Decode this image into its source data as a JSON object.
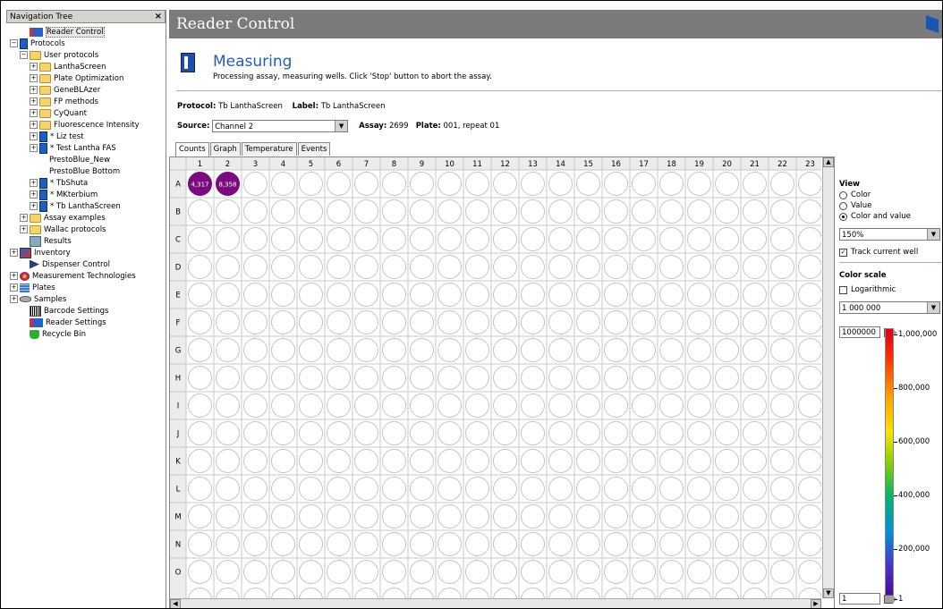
{
  "nav": {
    "title": "Navigation Tree",
    "close": "×",
    "items": [
      {
        "label": "Reader Control",
        "level": 1,
        "icon": "reader-control-icon",
        "cls": "reader",
        "expander": "",
        "selected": true
      },
      {
        "label": "Protocols",
        "level": 0,
        "icon": "protocol-icon",
        "cls": "proto",
        "expander": "−"
      },
      {
        "label": "User protocols",
        "level": 1,
        "icon": "folder-icon",
        "cls": "folder",
        "expander": "−"
      },
      {
        "label": "LanthaScreen",
        "level": 2,
        "icon": "folder-icon",
        "cls": "folder",
        "expander": "+"
      },
      {
        "label": "Plate Optimization",
        "level": 2,
        "icon": "folder-icon",
        "cls": "folder",
        "expander": "+"
      },
      {
        "label": "GeneBLAzer",
        "level": 2,
        "icon": "folder-icon",
        "cls": "folder",
        "expander": "+"
      },
      {
        "label": "FP methods",
        "level": 2,
        "icon": "folder-icon",
        "cls": "folder",
        "expander": "+"
      },
      {
        "label": "CyQuant",
        "level": 2,
        "icon": "folder-icon",
        "cls": "folder",
        "expander": "+"
      },
      {
        "label": "Fluorescence Intensity",
        "level": 2,
        "icon": "folder-icon",
        "cls": "folder",
        "expander": "+"
      },
      {
        "label": "* Liz test",
        "level": 2,
        "icon": "protocol-icon",
        "cls": "proto",
        "expander": "+"
      },
      {
        "label": "* Test Lantha FAS",
        "level": 2,
        "icon": "protocol-icon",
        "cls": "proto",
        "expander": "+"
      },
      {
        "label": "PrestoBlue_New",
        "level": 3,
        "icon": "",
        "cls": "",
        "expander": ""
      },
      {
        "label": "PrestoBlue Bottom",
        "level": 3,
        "icon": "",
        "cls": "",
        "expander": ""
      },
      {
        "label": "* TbShuta",
        "level": 2,
        "icon": "protocol-icon",
        "cls": "proto",
        "expander": "+"
      },
      {
        "label": "* MKterbium",
        "level": 2,
        "icon": "protocol-icon",
        "cls": "proto",
        "expander": "+"
      },
      {
        "label": "* Tb LanthaScreen",
        "level": 2,
        "icon": "protocol-icon",
        "cls": "proto",
        "expander": "+"
      },
      {
        "label": "Assay examples",
        "level": 1,
        "icon": "folder-icon",
        "cls": "folder",
        "expander": "+"
      },
      {
        "label": "Wallac protocols",
        "level": 1,
        "icon": "folder-icon",
        "cls": "folder",
        "expander": "+"
      },
      {
        "label": "Results",
        "level": 1,
        "icon": "results-icon",
        "cls": "results",
        "expander": ""
      },
      {
        "label": "Inventory",
        "level": 0,
        "icon": "inventory-icon",
        "cls": "inv",
        "expander": "+"
      },
      {
        "label": "Dispenser Control",
        "level": 1,
        "icon": "dispenser-icon",
        "cls": "disp",
        "expander": ""
      },
      {
        "label": "Measurement Technologies",
        "level": 0,
        "icon": "measurement-icon",
        "cls": "meas",
        "expander": "+"
      },
      {
        "label": "Plates",
        "level": 0,
        "icon": "plates-icon",
        "cls": "plates",
        "expander": "+"
      },
      {
        "label": "Samples",
        "level": 0,
        "icon": "samples-icon",
        "cls": "samples",
        "expander": "+"
      },
      {
        "label": "Barcode Settings",
        "level": 1,
        "icon": "barcode-icon",
        "cls": "barcode",
        "expander": ""
      },
      {
        "label": "Reader Settings",
        "level": 1,
        "icon": "reader-settings-icon",
        "cls": "reader",
        "expander": ""
      },
      {
        "label": "Recycle Bin",
        "level": 1,
        "icon": "recycle-bin-icon",
        "cls": "recycle",
        "expander": ""
      }
    ]
  },
  "window": {
    "title": "Reader Control"
  },
  "status": {
    "title": "Measuring",
    "description": "Processing assay, measuring wells. Click 'Stop' button to abort the assay."
  },
  "info": {
    "protocol_label": "Protocol:",
    "protocol_value": "Tb LanthaScreen",
    "label_label": "Label:",
    "label_value": "Tb LanthaScreen",
    "source_label": "Source:",
    "source_value": "Channel 2",
    "assay_label": "Assay:",
    "assay_value": "2699",
    "plate_label": "Plate:",
    "plate_value": "001,  repeat 01"
  },
  "tabs": [
    "Counts",
    "Graph",
    "Temperature",
    "Events"
  ],
  "plate": {
    "columns": [
      "1",
      "2",
      "3",
      "4",
      "5",
      "6",
      "7",
      "8",
      "9",
      "10",
      "11",
      "12",
      "13",
      "14",
      "15",
      "16",
      "17",
      "18",
      "19",
      "20",
      "21",
      "22",
      "23"
    ],
    "rows": [
      "A",
      "B",
      "C",
      "D",
      "E",
      "F",
      "G",
      "H",
      "I",
      "J",
      "K",
      "L",
      "M",
      "N",
      "O"
    ],
    "measured": [
      {
        "row": "A",
        "col": "1",
        "value": "4,317"
      },
      {
        "row": "A",
        "col": "2",
        "value": "8,358"
      }
    ],
    "measured_color": "#7a0a7e"
  },
  "view": {
    "heading": "View",
    "options": [
      "Color",
      "Value",
      "Color and value"
    ],
    "selected": "Color and value",
    "zoom": "150%",
    "track_label": "Track current well",
    "track_checked": true
  },
  "color_scale": {
    "heading": "Color scale",
    "log_label": "Logarithmic",
    "log_checked": false,
    "range_select": "1 000 000",
    "max_input": "1000000",
    "min_input": "1",
    "ticks": [
      "1,000,000",
      "800,000",
      "600,000",
      "400,000",
      "200,000",
      "1"
    ]
  }
}
